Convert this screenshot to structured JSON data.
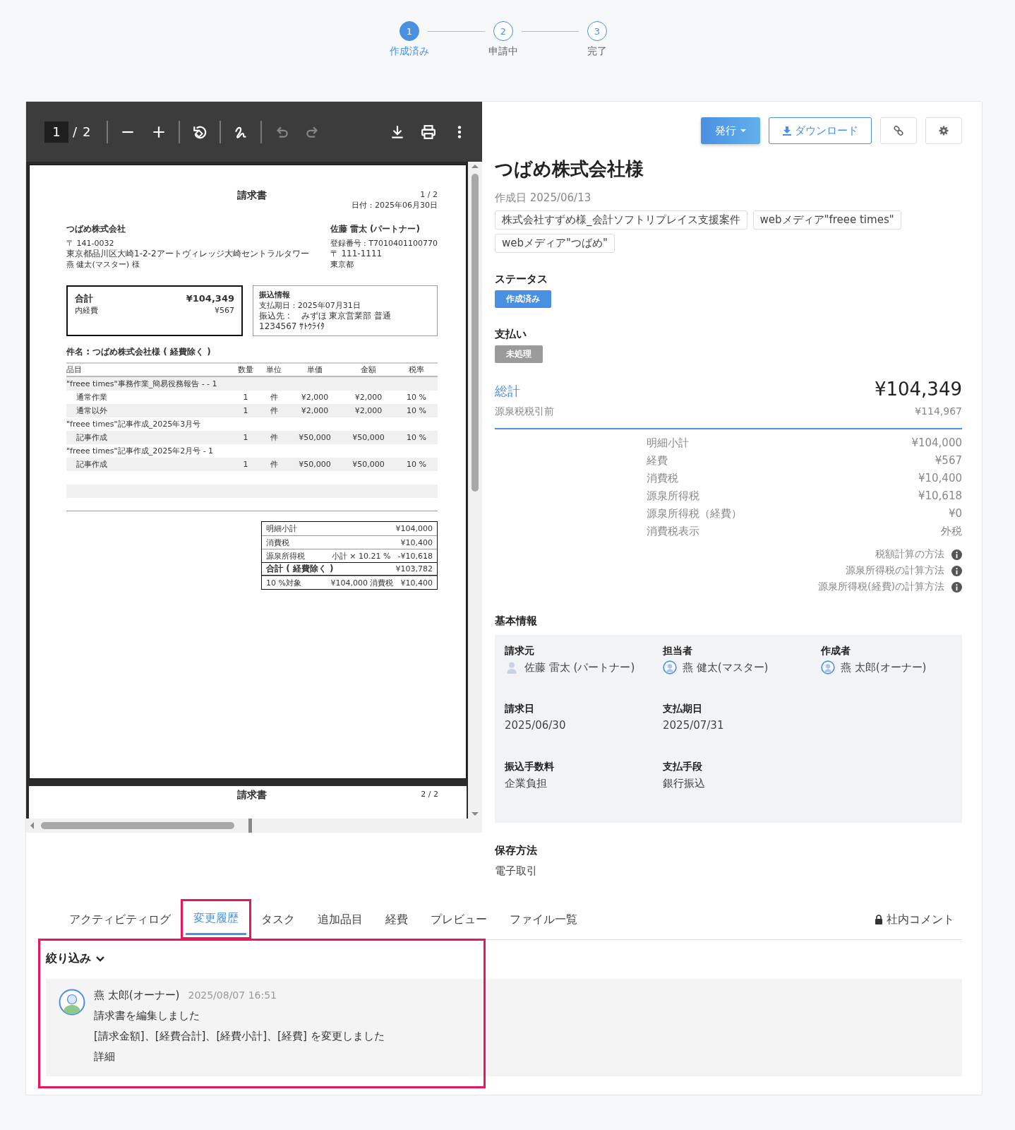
{
  "stepper": [
    {
      "number": "1",
      "label": "作成済み",
      "selected": true
    },
    {
      "number": "2",
      "label": "申請中",
      "selected": false
    },
    {
      "number": "3",
      "label": "完了",
      "selected": false
    }
  ],
  "pdf_viewer": {
    "toolbar": {
      "page": "1",
      "separator": "/",
      "page_count": "2",
      "tools": [
        {
          "kind": "zoom-out",
          "disabled": false
        },
        {
          "kind": "zoom-in",
          "disabled": false
        },
        {
          "kind": "rotate",
          "disabled": false
        },
        {
          "kind": "draw",
          "disabled": false
        },
        {
          "kind": "undo",
          "disabled": true
        },
        {
          "kind": "redo",
          "disabled": true
        },
        {
          "kind": "download",
          "disabled": false
        },
        {
          "kind": "print",
          "disabled": false
        },
        {
          "kind": "more",
          "disabled": false
        }
      ]
    },
    "page1": {
      "title": "請求書",
      "page_no": "1 / 2",
      "date": "日付 : 2025年06月30日",
      "client": {
        "name": "つばめ株式会社",
        "lines": [
          "〒 141-0032",
          "東京都品川区大崎1-2-2アートヴィレッジ大崎セントラルタワー",
          "燕 健太(マスター) 様"
        ]
      },
      "issuer": {
        "name": "佐藤 雷太 (パートナー)",
        "lines": [
          "登録番号 : T7010401100770",
          "〒 111-1111",
          "東京都"
        ]
      },
      "total_box": {
        "label": "合計",
        "amount": "¥104,349",
        "sub_label": "内経費",
        "sub_amount": "¥567"
      },
      "bank": {
        "title": "振込情報",
        "lines": [
          "支払期日 : 2025年07月31日",
          "振込先 :　 みずほ 東京営業部 普通 1234567 ｻﾄｳﾗｲﾀ"
        ]
      },
      "subject": "件名 : つばめ株式会社様 ( 経費除く )",
      "columns": [
        "品目",
        "数量",
        "単位",
        "単価",
        "金額",
        "税率"
      ],
      "rows": [
        {
          "kind": "group",
          "cells": [
            "\"freee times\"事務作業_簡易役務報告 - - 1"
          ]
        },
        {
          "kind": "item",
          "cells": [
            "通常作業",
            "1",
            "件",
            "¥2,000",
            "¥2,000",
            "10 %"
          ]
        },
        {
          "kind": "item",
          "cells": [
            "通常以外",
            "1",
            "件",
            "¥2,000",
            "¥2,000",
            "10 %"
          ]
        },
        {
          "kind": "group",
          "cells": [
            "\"freee times\"記事作成_2025年3月号"
          ]
        },
        {
          "kind": "item",
          "cells": [
            "記事作成",
            "1",
            "件",
            "¥50,000",
            "¥50,000",
            "10 %"
          ]
        },
        {
          "kind": "group",
          "cells": [
            "\"freee times\"記事作成_2025年2月号 - 1"
          ]
        },
        {
          "kind": "item",
          "cells": [
            "記事作成",
            "1",
            "件",
            "¥50,000",
            "¥50,000",
            "10 %"
          ]
        }
      ],
      "summary": [
        {
          "kind": "normal",
          "label": "明細小計",
          "value": "¥104,000"
        },
        {
          "kind": "normal",
          "label": "消費税",
          "value": "¥10,400"
        },
        {
          "kind": "normal",
          "label": "源泉所得税",
          "note": "小計 × 10.21 %",
          "value": "-¥10,618"
        },
        {
          "kind": "total",
          "label": "合計 ( 経費除く )",
          "value": "¥103,782"
        },
        {
          "kind": "normal",
          "label": "10 %対象",
          "note": "¥104,000 消費税",
          "value": "¥10,400"
        }
      ]
    },
    "page2": {
      "title": "請求書",
      "page_no": "2 / 2"
    }
  },
  "actions": [
    {
      "kind": "primary",
      "label": "発行"
    },
    {
      "kind": "download",
      "label": "ダウンロード"
    },
    {
      "kind": "link"
    },
    {
      "kind": "settings"
    }
  ],
  "title": "つばめ株式会社様",
  "created": "作成日 2025/06/13",
  "tags": [
    "株式会社すずめ様_会計ソフトリプレイス支援案件",
    "webメディア\"freee times\"",
    "webメディア\"つばめ\""
  ],
  "statuses": [
    {
      "heading": "ステータス",
      "badge": "作成済み",
      "color": "#4a90e2"
    },
    {
      "heading": "支払い",
      "badge": "未処理",
      "color": "#9b9b9b"
    }
  ],
  "totals": {
    "label": "総計",
    "amount": "¥104,349",
    "sub_label": "源泉税税引前",
    "sub_amount": "¥114,967",
    "breakdown": [
      {
        "label": "明細小計",
        "value": "¥104,000"
      },
      {
        "label": "経費",
        "value": "¥567"
      },
      {
        "label": "消費税",
        "value": "¥10,400"
      },
      {
        "label": "源泉所得税",
        "value": "¥10,618"
      },
      {
        "label": "源泉所得税（経費）",
        "value": "¥0"
      },
      {
        "label": "消費税表示",
        "value": "外税"
      }
    ],
    "help_links": [
      "税額計算の方法",
      "源泉所得税の計算方法",
      "源泉所得税(経費)の計算方法"
    ]
  },
  "basic_info": {
    "heading": "基本情報",
    "rows": [
      [
        {
          "label": "請求元",
          "value": "佐藤 雷太 (パートナー)",
          "kind": "partner"
        },
        {
          "label": "担当者",
          "value": "燕 健太(マスター)",
          "kind": "user"
        },
        {
          "label": "作成者",
          "value": "燕 太郎(オーナー)",
          "kind": "user"
        }
      ],
      [
        {
          "label": "請求日",
          "value": "2025/06/30"
        },
        {
          "label": "支払期日",
          "value": "2025/07/31"
        }
      ],
      [
        {
          "label": "振込手数料",
          "value": "企業負担"
        },
        {
          "label": "支払手段",
          "value": "銀行振込"
        }
      ]
    ]
  },
  "storage": {
    "heading": "保存方法",
    "value": "電子取引"
  },
  "tabs": [
    {
      "label": "アクティビティログ",
      "selected": false,
      "highlighted": false
    },
    {
      "label": "変更履歴",
      "selected": true,
      "highlighted": true
    },
    {
      "label": "タスク",
      "selected": false,
      "highlighted": false
    },
    {
      "label": "追加品目",
      "selected": false,
      "highlighted": false
    },
    {
      "label": "経費",
      "selected": false,
      "highlighted": false
    },
    {
      "label": "プレビュー",
      "selected": false,
      "highlighted": false
    },
    {
      "label": "ファイル一覧",
      "selected": false,
      "highlighted": false
    },
    {
      "label": "社内コメント",
      "selected": false,
      "highlighted": false,
      "kind": "private"
    }
  ],
  "filter": {
    "label": "絞り込み",
    "expanded": false
  },
  "history": [
    {
      "author": "燕 太郎(オーナー)",
      "time": "2025/08/07 16:51",
      "lines": [
        "請求書を編集しました",
        "[請求金額]、[経費合計]、[経費小計]、[経費] を変更しました"
      ],
      "link": "詳細"
    }
  ],
  "history_highlighted": true
}
